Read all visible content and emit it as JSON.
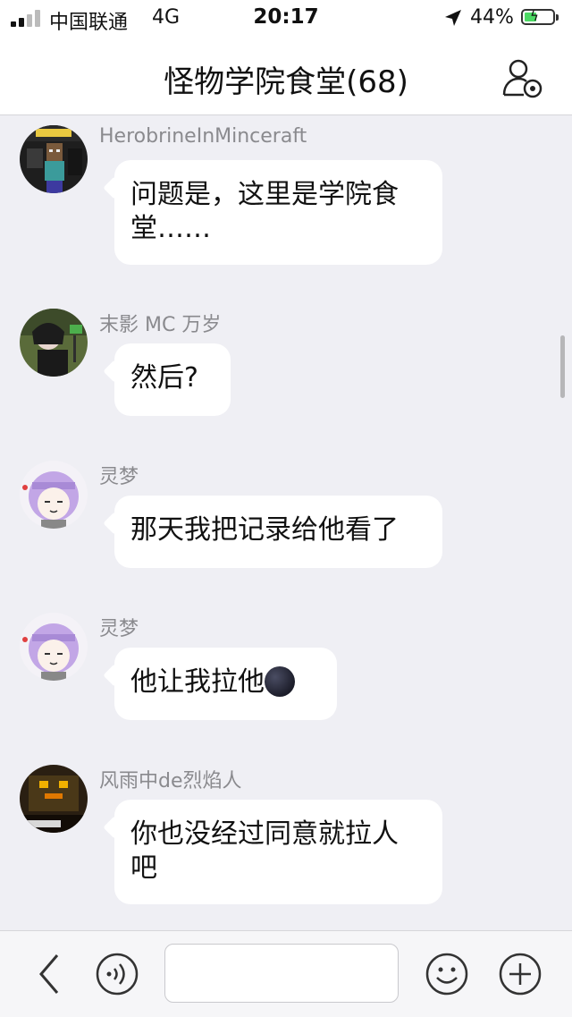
{
  "status_bar": {
    "carrier": "中国联通",
    "network": "4G",
    "time": "20:17",
    "battery": "44%",
    "battery_level": 0.44
  },
  "header": {
    "title": "怪物学院食堂(68)",
    "group_settings_icon": "person-gear-icon"
  },
  "messages": [
    {
      "sender": "HerobrineInMinceraft",
      "lines": [
        "问题是，这里是学院食",
        "堂……"
      ]
    },
    {
      "sender": "末影 MC 万岁",
      "lines": [
        "然后?"
      ]
    },
    {
      "sender": "灵梦",
      "lines": [
        "那天我把记录给他看了"
      ]
    },
    {
      "sender": "灵梦",
      "lines": [
        "他让我拉他"
      ],
      "emoji": "new-moon-face"
    },
    {
      "sender": "风雨中de烈焰人",
      "lines": [
        "你也没经过同意就拉人",
        "吧"
      ]
    }
  ],
  "input_bar": {
    "back_icon": "chevron-left-icon",
    "voice_icon": "voice-icon",
    "input_value": "",
    "emoji_icon": "smiley-icon",
    "plus_icon": "plus-icon"
  },
  "colors": {
    "chat_background": "#efeff4",
    "bubble": "#ffffff",
    "sender_name": "#8a8a8e",
    "battery_fill": "#4cd964"
  }
}
